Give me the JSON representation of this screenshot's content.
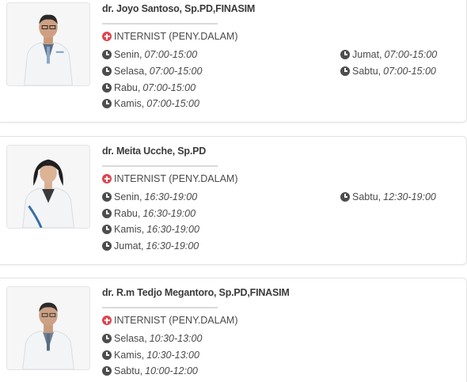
{
  "doctors": [
    {
      "name": "dr. Joyo Santoso, Sp.PD,FINASIM",
      "specialty": "INTERNIST (PENY.DALAM)",
      "schedule_left": [
        {
          "day": "Senin,",
          "time": "07:00-15:00"
        },
        {
          "day": "Selasa,",
          "time": "07:00-15:00"
        },
        {
          "day": "Rabu,",
          "time": "07:00-15:00"
        },
        {
          "day": "Kamis,",
          "time": "07:00-15:00"
        }
      ],
      "schedule_right": [
        {
          "day": "Jumat,",
          "time": "07:00-15:00"
        },
        {
          "day": "Sabtu,",
          "time": "07:00-15:00"
        }
      ]
    },
    {
      "name": "dr. Meita Ucche, Sp.PD",
      "specialty": "INTERNIST (PENY.DALAM)",
      "schedule_left": [
        {
          "day": "Senin,",
          "time": "16:30-19:00"
        },
        {
          "day": "Rabu,",
          "time": "16:30-19:00"
        },
        {
          "day": "Kamis,",
          "time": "16:30-19:00"
        },
        {
          "day": "Jumat,",
          "time": "16:30-19:00"
        }
      ],
      "schedule_right": [
        {
          "day": "Sabtu,",
          "time": "12:30-19:00"
        }
      ]
    },
    {
      "name": "dr. R.m Tedjo Megantoro, Sp.PD,FINASIM",
      "specialty": "INTERNIST (PENY.DALAM)",
      "schedule_left": [
        {
          "day": "Selasa,",
          "time": "10:30-13:00"
        },
        {
          "day": "Kamis,",
          "time": "10:30-13:00"
        },
        {
          "day": "Sabtu,",
          "time": "10:00-12:00"
        }
      ],
      "schedule_right": []
    }
  ],
  "colors": {
    "specialty_icon": "#e0454f",
    "clock_icon": "#4d4d4d",
    "text": "#4a4a4a"
  },
  "icons": {
    "specialty": "plus-circle-icon",
    "schedule": "clock-icon"
  }
}
